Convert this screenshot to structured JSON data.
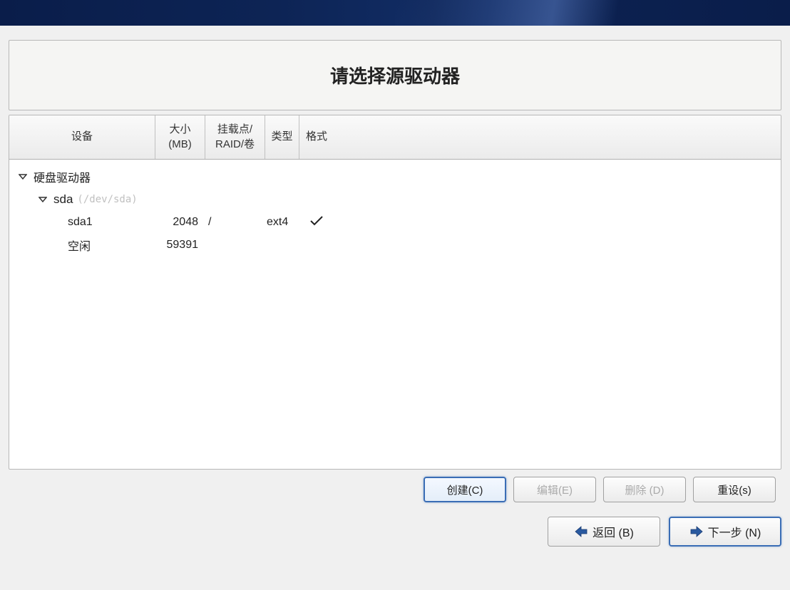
{
  "title": "请选择源驱动器",
  "headers": {
    "device": "设备",
    "size": "大小\n(MB)",
    "mount": "挂载点/\nRAID/卷",
    "type": "类型",
    "format": "格式"
  },
  "tree": {
    "root_label": "硬盘驱动器",
    "disk": {
      "name": "sda",
      "path": "(/dev/sda)"
    },
    "partitions": [
      {
        "name": "sda1",
        "size": "2048",
        "mount": "/",
        "type": "ext4",
        "format_check": true
      },
      {
        "name": "空闲",
        "size": "59391",
        "mount": "",
        "type": "",
        "format_check": false
      }
    ]
  },
  "buttons": {
    "create": "创建(C)",
    "edit": "编辑(E)",
    "delete": "删除 (D)",
    "reset": "重设(s)"
  },
  "nav": {
    "back": "返回 (B)",
    "next": "下一步 (N)"
  }
}
